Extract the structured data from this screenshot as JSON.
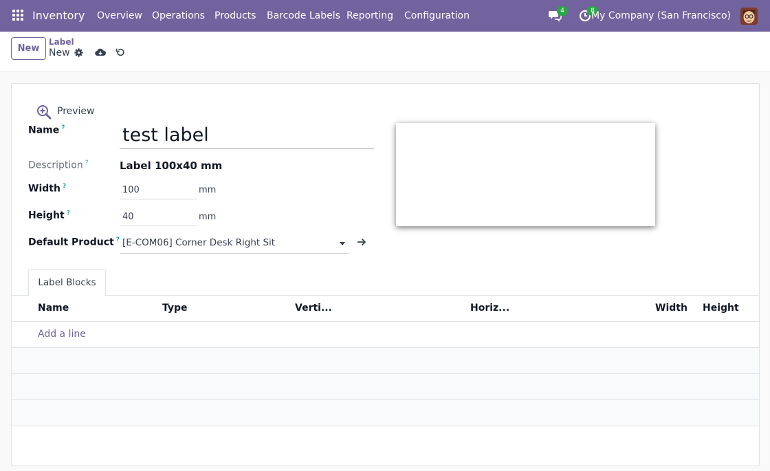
{
  "topbar": {
    "app_name": "Inventory",
    "menu": [
      "Overview",
      "Operations",
      "Products",
      "Barcode Labels",
      "Reporting",
      "Configuration"
    ],
    "messages_badge": "4",
    "activities_badge": "8",
    "company": "My Company (San Francisco)",
    "icons": {
      "apps": "apps-grid-icon",
      "messages": "chat-icon",
      "activities": "clock-icon"
    },
    "accent_color": "#71639e"
  },
  "controlbar": {
    "new_label": "New",
    "breadcrumb_parent": "Label",
    "breadcrumb_current": "New"
  },
  "form": {
    "preview_label": "Preview",
    "name_label": "Name",
    "name_value": "test label",
    "description_label": "Description",
    "description_value": "Label 100x40 mm",
    "width_label": "Width",
    "width_value": "100",
    "width_unit": "mm",
    "height_label": "Height",
    "height_value": "40",
    "height_unit": "mm",
    "default_product_label": "Default Product",
    "default_product_value": "[E-COM06] Corner Desk Right Sit",
    "help_marker": "?"
  },
  "tabs": [
    "Label Blocks"
  ],
  "table": {
    "columns": [
      "Name",
      "Type",
      "Verti...",
      "Horiz...",
      "Width",
      "Height"
    ],
    "add_line": "Add a line"
  }
}
